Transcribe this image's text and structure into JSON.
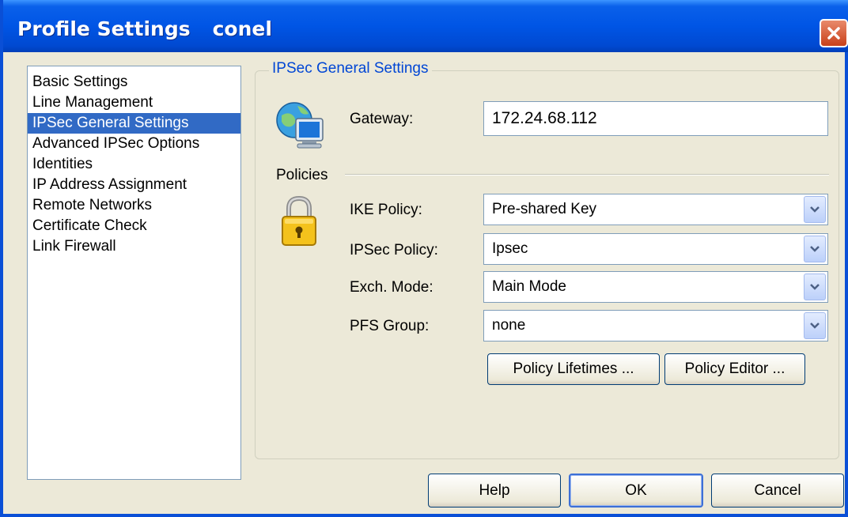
{
  "window": {
    "title": "Profile Settings",
    "profile_name": "conel"
  },
  "sidebar": {
    "items": [
      {
        "label": "Basic Settings"
      },
      {
        "label": "Line Management"
      },
      {
        "label": "IPSec General Settings",
        "selected": true
      },
      {
        "label": "Advanced IPSec Options"
      },
      {
        "label": "Identities"
      },
      {
        "label": "IP Address Assignment"
      },
      {
        "label": "Remote Networks"
      },
      {
        "label": "Certificate Check"
      },
      {
        "label": "Link Firewall"
      }
    ]
  },
  "main": {
    "group_title": "IPSec General Settings",
    "gateway": {
      "label": "Gateway:",
      "value": "172.24.68.112"
    },
    "policies_label": "Policies",
    "ike_policy": {
      "label": "IKE Policy:",
      "value": "Pre-shared Key"
    },
    "ipsec_policy": {
      "label": "IPSec Policy:",
      "value": "Ipsec"
    },
    "exch_mode": {
      "label": "Exch. Mode:",
      "value": "Main Mode"
    },
    "pfs_group": {
      "label": "PFS Group:",
      "value": "none"
    },
    "policy_lifetimes_label": "Policy Lifetimes ...",
    "policy_editor_label": "Policy Editor ..."
  },
  "footer": {
    "help_label": "Help",
    "ok_label": "OK",
    "cancel_label": "Cancel"
  },
  "icons": {
    "gateway": "network-computer-icon",
    "policies": "padlock-icon",
    "close": "close-icon",
    "dropdown": "chevron-down-icon"
  },
  "colors": {
    "titlebar": "#0055e5",
    "selection": "#316ac5",
    "group_title": "#0046d5",
    "close_button": "#c8401a"
  }
}
